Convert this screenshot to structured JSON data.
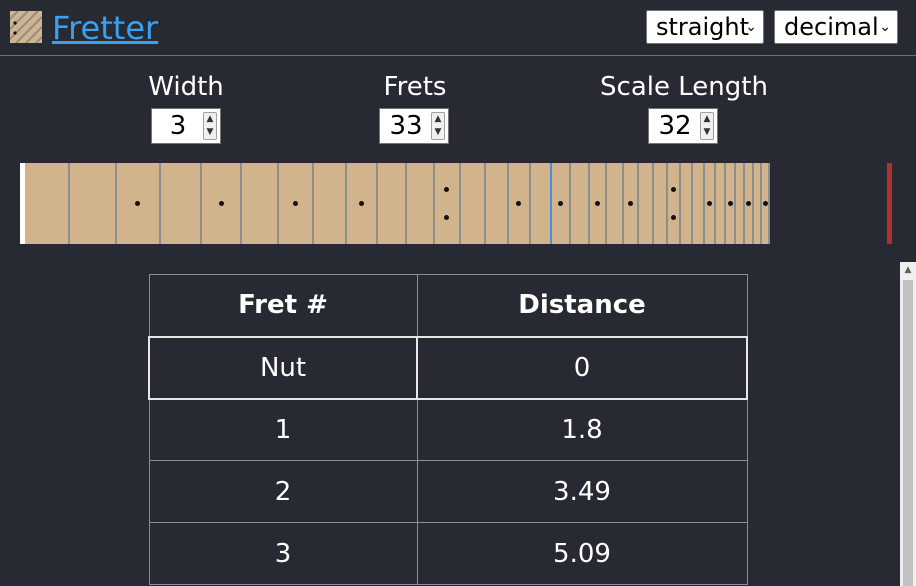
{
  "header": {
    "app_title": "Fretter",
    "style_select": {
      "selected": "straight"
    },
    "units_select": {
      "selected": "decimal"
    }
  },
  "controls": {
    "width": {
      "label": "Width",
      "value": "3"
    },
    "frets": {
      "label": "Frets",
      "value": "33"
    },
    "scale_length": {
      "label": "Scale Length",
      "value": "32"
    }
  },
  "fretboard": {
    "fret_count": 33,
    "scale_length": 32,
    "single_inlay_frets": [
      3,
      5,
      7,
      9,
      15,
      17,
      19,
      21,
      27,
      29,
      31,
      33
    ],
    "double_inlay_frets": [
      12,
      24
    ],
    "wood_color": "#d1b48c",
    "nut_color": "#ffffff",
    "bridge_color": "#b03030",
    "center_fret_color": "#4a90d9"
  },
  "table": {
    "headers": [
      "Fret #",
      "Distance"
    ],
    "rows": [
      {
        "fret": "Nut",
        "distance": "0"
      },
      {
        "fret": "1",
        "distance": "1.8"
      },
      {
        "fret": "2",
        "distance": "3.49"
      },
      {
        "fret": "3",
        "distance": "5.09"
      }
    ]
  },
  "icons": {
    "logo": "fretboard-logo-icon",
    "select_chevron": "chevron-down-icon",
    "spin_up": "arrow-up-icon",
    "spin_down": "arrow-down-icon"
  },
  "colors": {
    "background": "#272a33",
    "link": "#3aa0f0"
  }
}
